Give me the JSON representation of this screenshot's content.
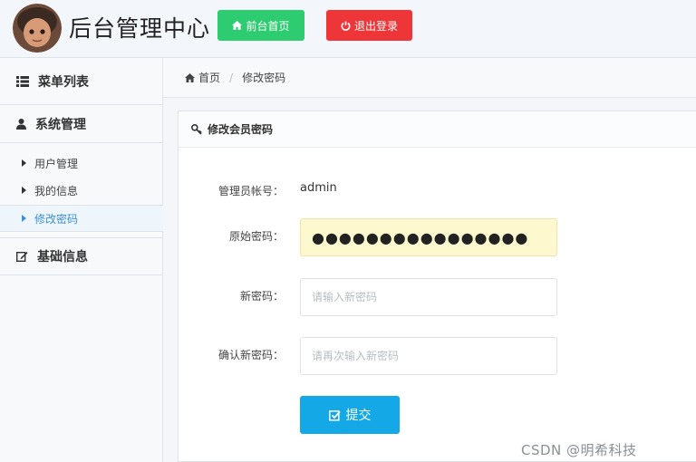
{
  "header": {
    "site_title": "后台管理中心",
    "front_button": "前台首页",
    "logout_button": "退出登录"
  },
  "sidebar": {
    "menu_title": "菜单列表",
    "groups": [
      {
        "label": "系统管理",
        "items": [
          {
            "label": "用户管理",
            "active": false
          },
          {
            "label": "我的信息",
            "active": false
          },
          {
            "label": "修改密码",
            "active": true
          }
        ]
      },
      {
        "label": "基础信息",
        "items": []
      }
    ]
  },
  "breadcrumb": {
    "home": "首页",
    "current": "修改密码"
  },
  "panel": {
    "title": "修改会员密码"
  },
  "form": {
    "account_label": "管理员帐号：",
    "account_value": "admin",
    "old_password_label": "原始密码：",
    "old_password_value": "●●●●●●●●●●●●●●●●",
    "new_password_label": "新密码：",
    "new_password_placeholder": "请输入新密码",
    "confirm_password_label": "确认新密码：",
    "confirm_password_placeholder": "请再次输入新密码",
    "submit_label": "提交"
  },
  "watermark": "CSDN @明希科技",
  "colors": {
    "front_button": "#2ecc71",
    "logout_button": "#ee3639",
    "submit_button": "#14a9e6",
    "active_menu_text": "#3a8fd6",
    "filled_input_bg": "#fdf8cd"
  }
}
